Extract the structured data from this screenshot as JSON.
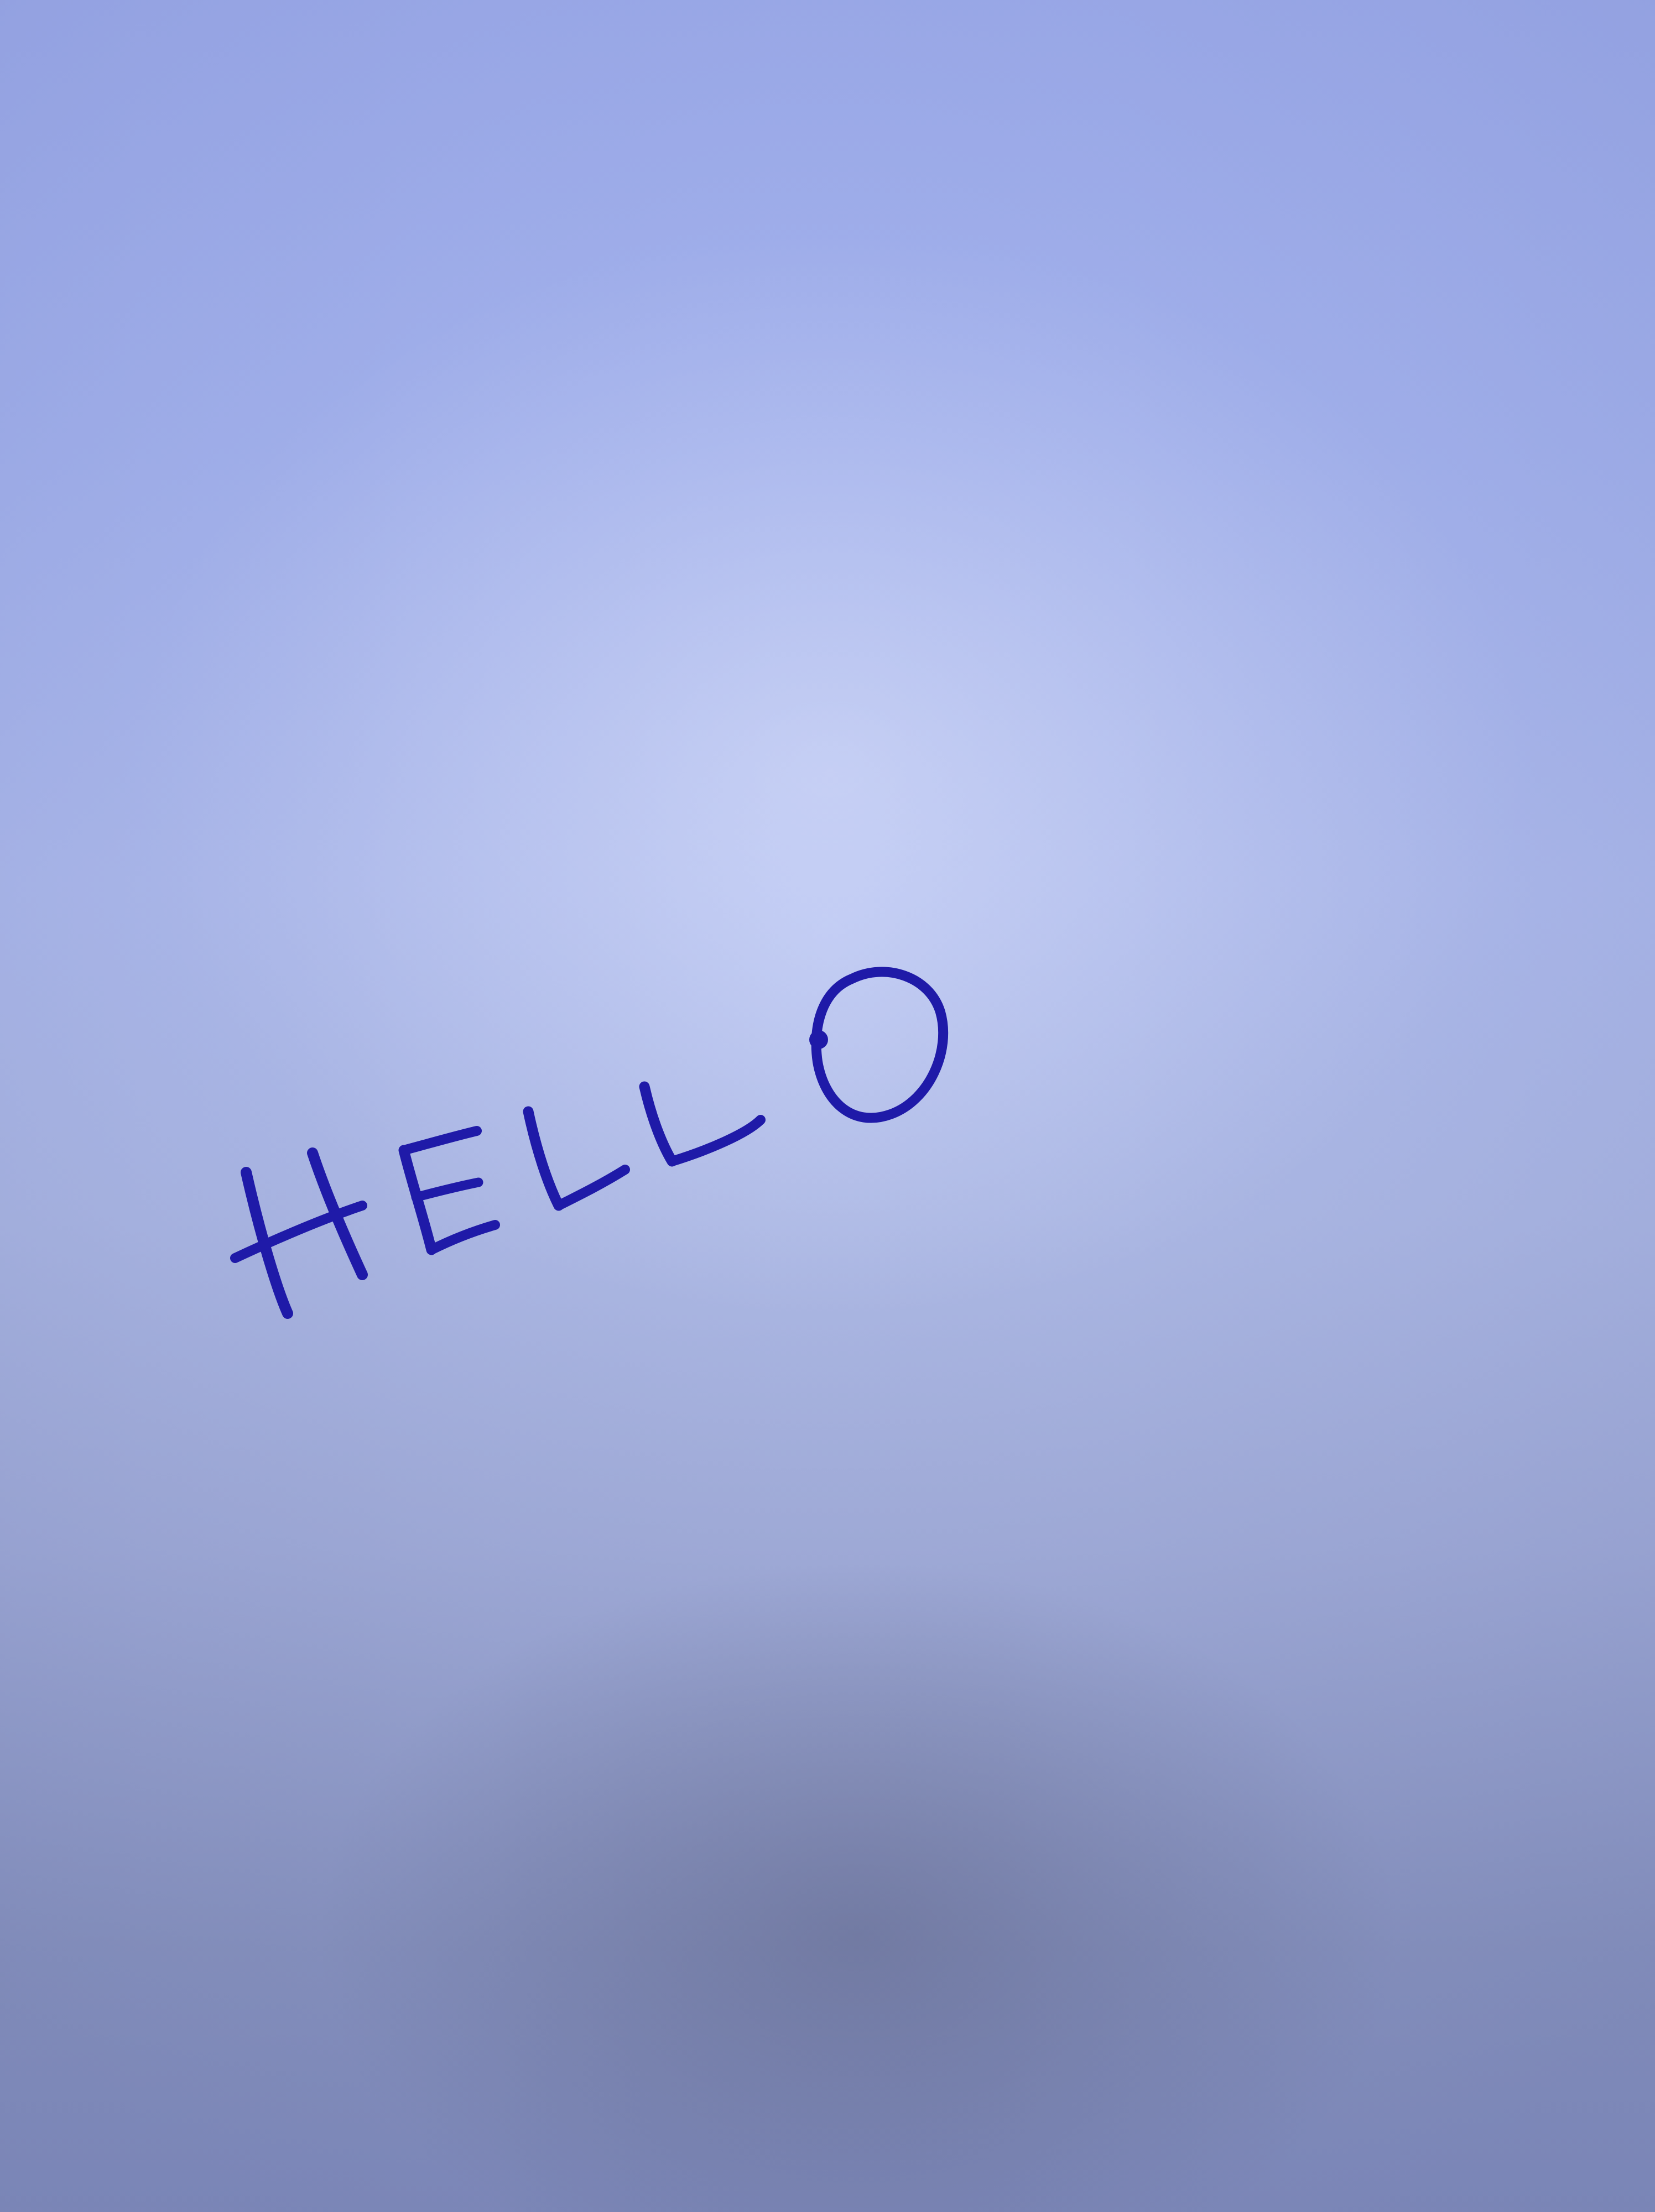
{
  "scene": {
    "description_type": "handwriting-on-paper",
    "handwritten_word": "HELLO",
    "ink_color": "#1f1aa8",
    "paper_color": "#aab8f2",
    "shadow_color": "#7f88b8"
  }
}
